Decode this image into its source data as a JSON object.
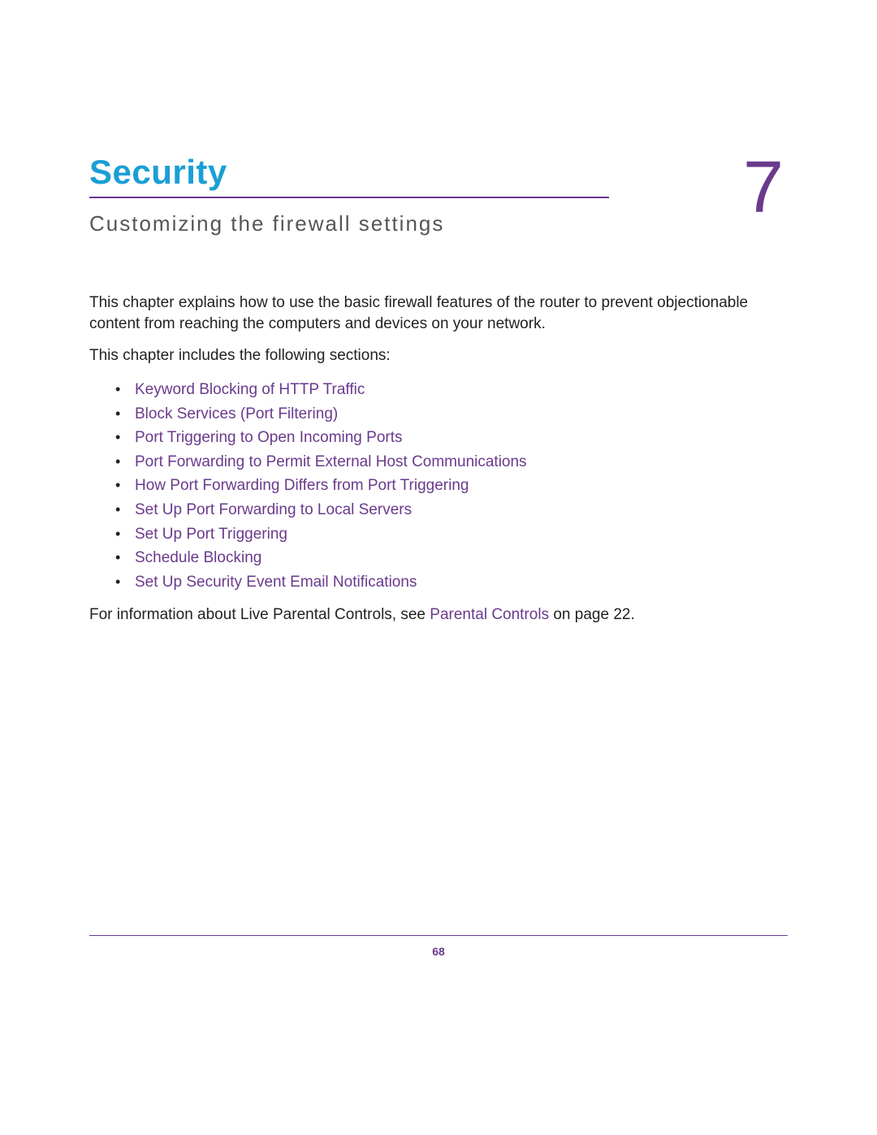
{
  "chapter": {
    "title": "Security",
    "number": "7",
    "subtitle": "Customizing the firewall settings"
  },
  "intro": "This chapter explains how to use the basic firewall features of the router to prevent objectionable content from reaching the computers and devices on your network.",
  "sections_lead": "This chapter includes the following sections:",
  "sections": [
    "Keyword Blocking of HTTP Traffic",
    "Block Services (Port Filtering)",
    "Port Triggering to Open Incoming Ports",
    "Port Forwarding to Permit External Host Communications",
    "How Port Forwarding Differs from Port Triggering",
    "Set Up Port Forwarding to Local Servers",
    "Set Up Port Triggering",
    "Schedule Blocking",
    "Set Up Security Event Email Notifications"
  ],
  "footer_note": {
    "pre": "For information about Live Parental Controls, see ",
    "link": "Parental Controls",
    "post": " on page 22."
  },
  "page_number": "68"
}
